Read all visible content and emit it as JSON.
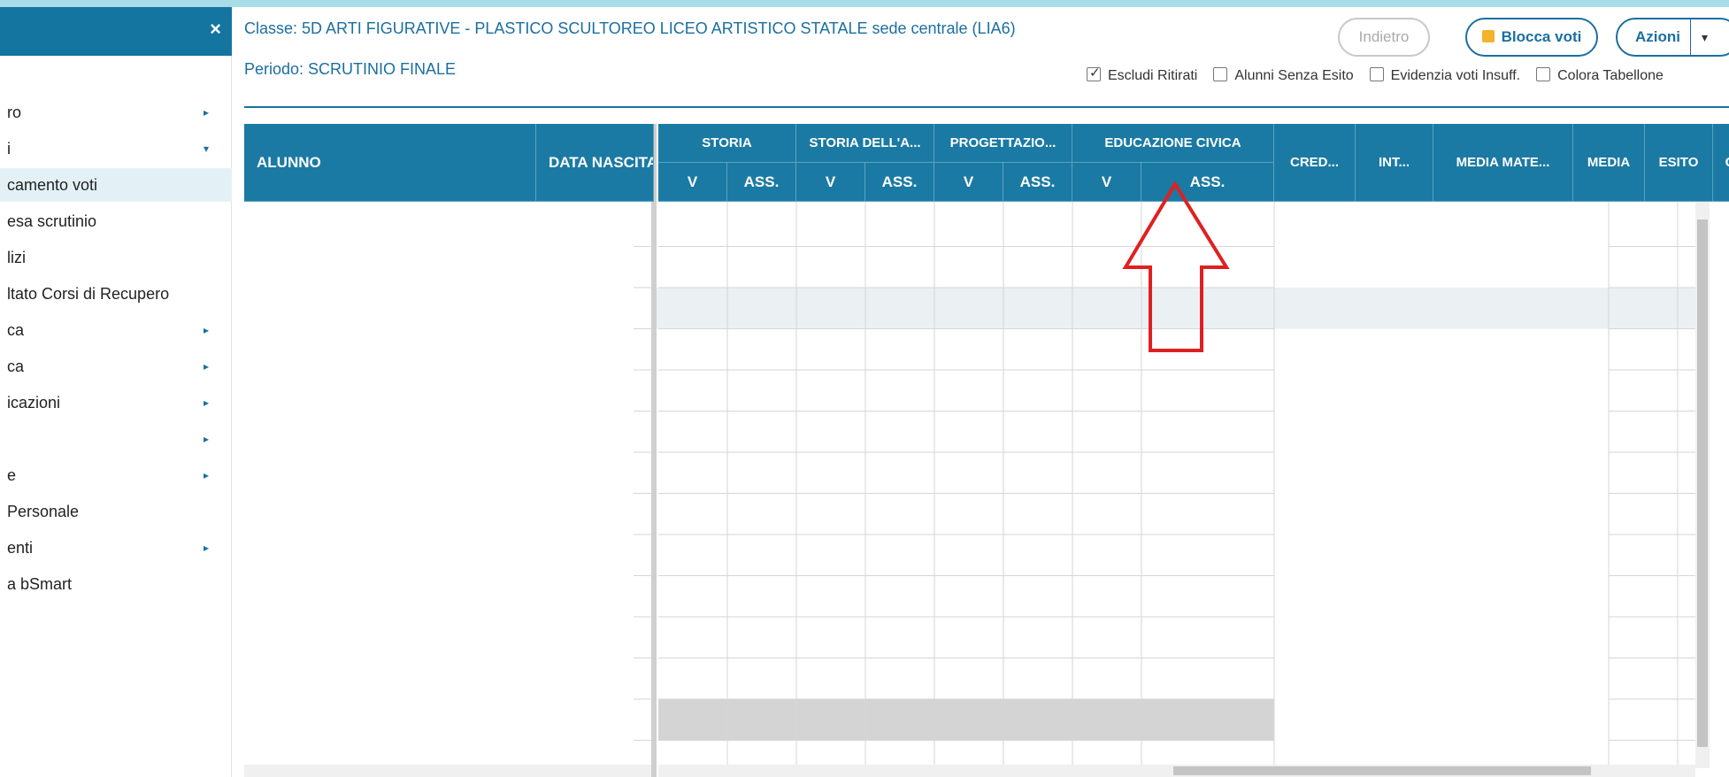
{
  "sidebar": {
    "close_icon": "×",
    "items": [
      {
        "label": "ro",
        "arrow": "▸",
        "active": false
      },
      {
        "label": "i",
        "arrow": "▾",
        "active": false
      },
      {
        "label": "camento voti",
        "arrow": "",
        "active": true
      },
      {
        "label": "esa scrutinio",
        "arrow": "",
        "active": false
      },
      {
        "label": "lizi",
        "arrow": "",
        "active": false
      },
      {
        "label": "ltato Corsi di Recupero",
        "arrow": "",
        "active": false
      },
      {
        "label": "ca",
        "arrow": "▸",
        "active": false
      },
      {
        "label": "ca",
        "arrow": "▸",
        "active": false
      },
      {
        "label": "icazioni",
        "arrow": "▸",
        "active": false
      },
      {
        "label": "",
        "arrow": "▸",
        "active": false
      },
      {
        "label": "e",
        "arrow": "▸",
        "active": false
      },
      {
        "label": "Personale",
        "arrow": "",
        "active": false
      },
      {
        "label": "enti",
        "arrow": "▸",
        "active": false
      },
      {
        "label": "a bSmart",
        "arrow": "",
        "active": false
      }
    ]
  },
  "header": {
    "class_title": "Classe: 5D ARTI FIGURATIVE - PLASTICO SCULTOREO LICEO ARTISTICO STATALE sede centrale (LIA6)",
    "period": "Periodo: SCRUTINIO FINALE",
    "buttons": {
      "back": "Indietro",
      "lock": "Blocca voti",
      "actions": "Azioni",
      "actions_caret": "▾"
    },
    "options": [
      {
        "label": "Escludi Ritirati",
        "checked": true
      },
      {
        "label": "Alunni Senza Esito",
        "checked": false
      },
      {
        "label": "Evidenzia voti Insuff.",
        "checked": false
      },
      {
        "label": "Colora Tabellone",
        "checked": false
      }
    ]
  },
  "grid": {
    "frozen_columns": [
      "ALUNNO",
      "DATA NASCITA"
    ],
    "subject_groups": [
      {
        "name": "STORIA",
        "sub": [
          "V",
          "ASS."
        ]
      },
      {
        "name": "STORIA DELL'A...",
        "sub": [
          "V",
          "ASS."
        ]
      },
      {
        "name": "PROGETTAZIO...",
        "sub": [
          "V",
          "ASS."
        ]
      },
      {
        "name": "EDUCAZIONE CIVICA",
        "sub": [
          "V",
          "ASS."
        ]
      }
    ],
    "summary_columns": [
      "CRED...",
      "INT...",
      "MEDIA MATE...",
      "MEDIA",
      "ESITO",
      "G"
    ]
  },
  "colors": {
    "header_blue": "#1b7aa3",
    "annotation_red": "#e02020"
  }
}
